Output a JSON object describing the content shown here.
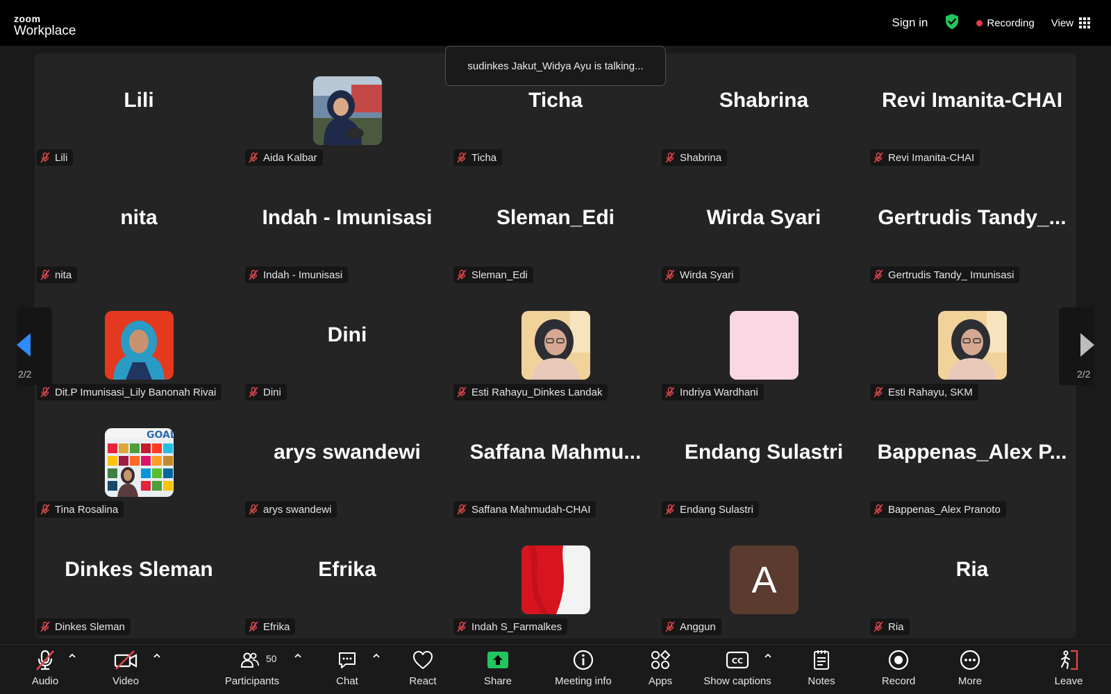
{
  "app": {
    "logo_top": "zoom",
    "logo_bottom": "Workplace"
  },
  "topbar": {
    "sign_in": "Sign in",
    "recording": "Recording",
    "view": "View"
  },
  "toast": "sudinkes Jakut_Widya Ayu is talking...",
  "pager": {
    "left": "2/2",
    "right": "2/2"
  },
  "participants": [
    {
      "label": "Lili",
      "display": "Lili",
      "kind": "text"
    },
    {
      "label": "Aida Kalbar",
      "kind": "photo",
      "photo": "hijab-outdoor"
    },
    {
      "label": "Ticha",
      "display": "Ticha",
      "kind": "text"
    },
    {
      "label": "Shabrina",
      "display": "Shabrina",
      "kind": "text"
    },
    {
      "label": "Revi Imanita-CHAI",
      "display": "Revi Imanita-CHAI",
      "kind": "text"
    },
    {
      "label": "nita",
      "display": "nita",
      "kind": "text"
    },
    {
      "label": "Indah - Imunisasi",
      "display": "Indah - Imunisasi",
      "kind": "text"
    },
    {
      "label": "Sleman_Edi",
      "display": "Sleman_Edi",
      "kind": "text"
    },
    {
      "label": "Wirda Syari",
      "display": "Wirda Syari",
      "kind": "text"
    },
    {
      "label": "Gertrudis Tandy_ Imunisasi",
      "display": "Gertrudis  Tandy_...",
      "kind": "text"
    },
    {
      "label": "Dit.P Imunisasi_Lily Banonah Rivai",
      "kind": "photo",
      "photo": "hijab-red"
    },
    {
      "label": "Dini",
      "display": "Dini",
      "kind": "text"
    },
    {
      "label": "Esti Rahayu_Dinkes Landak",
      "kind": "photo",
      "photo": "woman-glasses"
    },
    {
      "label": "Indriya Wardhani",
      "kind": "photo",
      "photo": "pink"
    },
    {
      "label": "Esti Rahayu, SKM",
      "kind": "photo",
      "photo": "woman-glasses"
    },
    {
      "label": "Tina Rosalina",
      "kind": "photo",
      "photo": "sdg-goals"
    },
    {
      "label": "arys swandewi",
      "display": "arys swandewi",
      "kind": "text"
    },
    {
      "label": "Saffana Mahmudah-CHAI",
      "display": "Saffana  Mahmu...",
      "kind": "text"
    },
    {
      "label": "Endang Sulastri",
      "display": "Endang Sulastri",
      "kind": "text"
    },
    {
      "label": "Bappenas_Alex Pranoto",
      "display": "Bappenas_Alex  P...",
      "kind": "text"
    },
    {
      "label": "Dinkes Sleman",
      "display": "Dinkes Sleman",
      "kind": "text"
    },
    {
      "label": "Efrika",
      "display": "Efrika",
      "kind": "text"
    },
    {
      "label": "Indah S_Farmalkes",
      "kind": "photo",
      "photo": "red-white-flag"
    },
    {
      "label": "Anggun",
      "kind": "letter",
      "letter": "A"
    },
    {
      "label": "Ria",
      "display": "Ria",
      "kind": "text"
    }
  ],
  "toolbar": {
    "audio": "Audio",
    "video": "Video",
    "participants": "Participants",
    "participants_count": "50",
    "chat": "Chat",
    "react": "React",
    "share": "Share",
    "meeting_info": "Meeting info",
    "apps": "Apps",
    "captions": "Show captions",
    "notes": "Notes",
    "record": "Record",
    "more": "More",
    "leave": "Leave"
  },
  "colors": {
    "accent_blue": "#2d8cff",
    "share_green": "#22c55e",
    "muted_red": "#e5484d",
    "recording_red": "#f0384b",
    "shield_green": "#22c55e"
  }
}
